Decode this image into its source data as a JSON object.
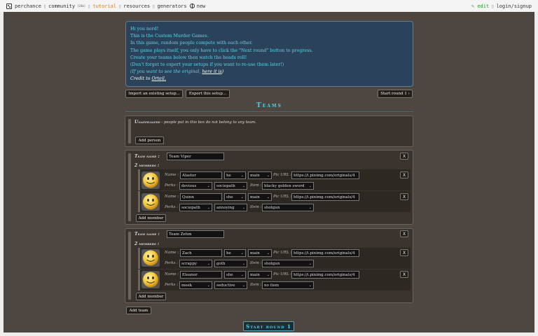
{
  "topbar": {
    "brand": "perchance",
    "community": "community",
    "community_count": "(24k)",
    "tutorial": "tutorial",
    "resources": "resources",
    "generators": "generators",
    "new": "new",
    "edit": "✎ edit",
    "login": "login/signup"
  },
  "intro": {
    "line1": "Hi you nerd!",
    "line2": "This is the Custom Murder Games.",
    "line3": "In this game, random people compete with each other.",
    "line4": "The game plays itself, you only have to click the \"Next round\" button to progress.",
    "line5": "Create your teams below then watch the heads roll!",
    "line6": "(Don't forget to export your setups if you want to re-use them later!)",
    "line7a": "(If you want to see the original,",
    "line7b": "here it is",
    "line7c": ")",
    "line8a": "Credit to",
    "line8b": "Orteil."
  },
  "buttons": {
    "import": "Import an existing setup...",
    "export": "Export this setup...",
    "start_round_top": "Start round 1 ›",
    "add_person": "Add person",
    "add_team": "Add team",
    "start_round_bottom": "Start round 1"
  },
  "teams_heading": "Teams",
  "unaffiliated": {
    "title": "Unaffiliated",
    "desc": "- people put in this box do not belong to any team."
  },
  "labels": {
    "team_name": "Team name :",
    "name": "Name :",
    "perks": "Perks :",
    "item": "Item :",
    "pic_url": "Pic URL :",
    "add_member": "Add member",
    "x": "X"
  },
  "teams": [
    {
      "name": "Team Viper",
      "members_label": "2 members :",
      "members": [
        {
          "name": "Alastor",
          "pronoun": "he",
          "role": "main",
          "pic_url": "https://i.pinimg.com/originals/4",
          "perk1": "devious",
          "perk2": "sociopath",
          "item": "blacky golden sword"
        },
        {
          "name": "Quinn",
          "pronoun": "she",
          "role": "main",
          "pic_url": "https://i.pinimg.com/originals/4",
          "perk1": "sociopath",
          "perk2": "annoying",
          "item": "shotgun"
        }
      ]
    },
    {
      "name": "Team Zehm",
      "members_label": "2 members :",
      "members": [
        {
          "name": "Zach",
          "pronoun": "he",
          "role": "main",
          "pic_url": "https://i.pinimg.com/originals/4",
          "perk1": "scrappy",
          "perk2": "goth",
          "item": "shotgun"
        },
        {
          "name": "Eleanor",
          "pronoun": "she",
          "role": "main",
          "pic_url": "https://i.pinimg.com/originals/4",
          "perk1": "meek",
          "perk2": "seductive",
          "item": "no item"
        }
      ]
    }
  ],
  "colors": {
    "page_bg": "#4e4741",
    "intro_bg": "#2b435a",
    "intro_text": "#5fd3ea",
    "heading": "#4fd0e8"
  }
}
